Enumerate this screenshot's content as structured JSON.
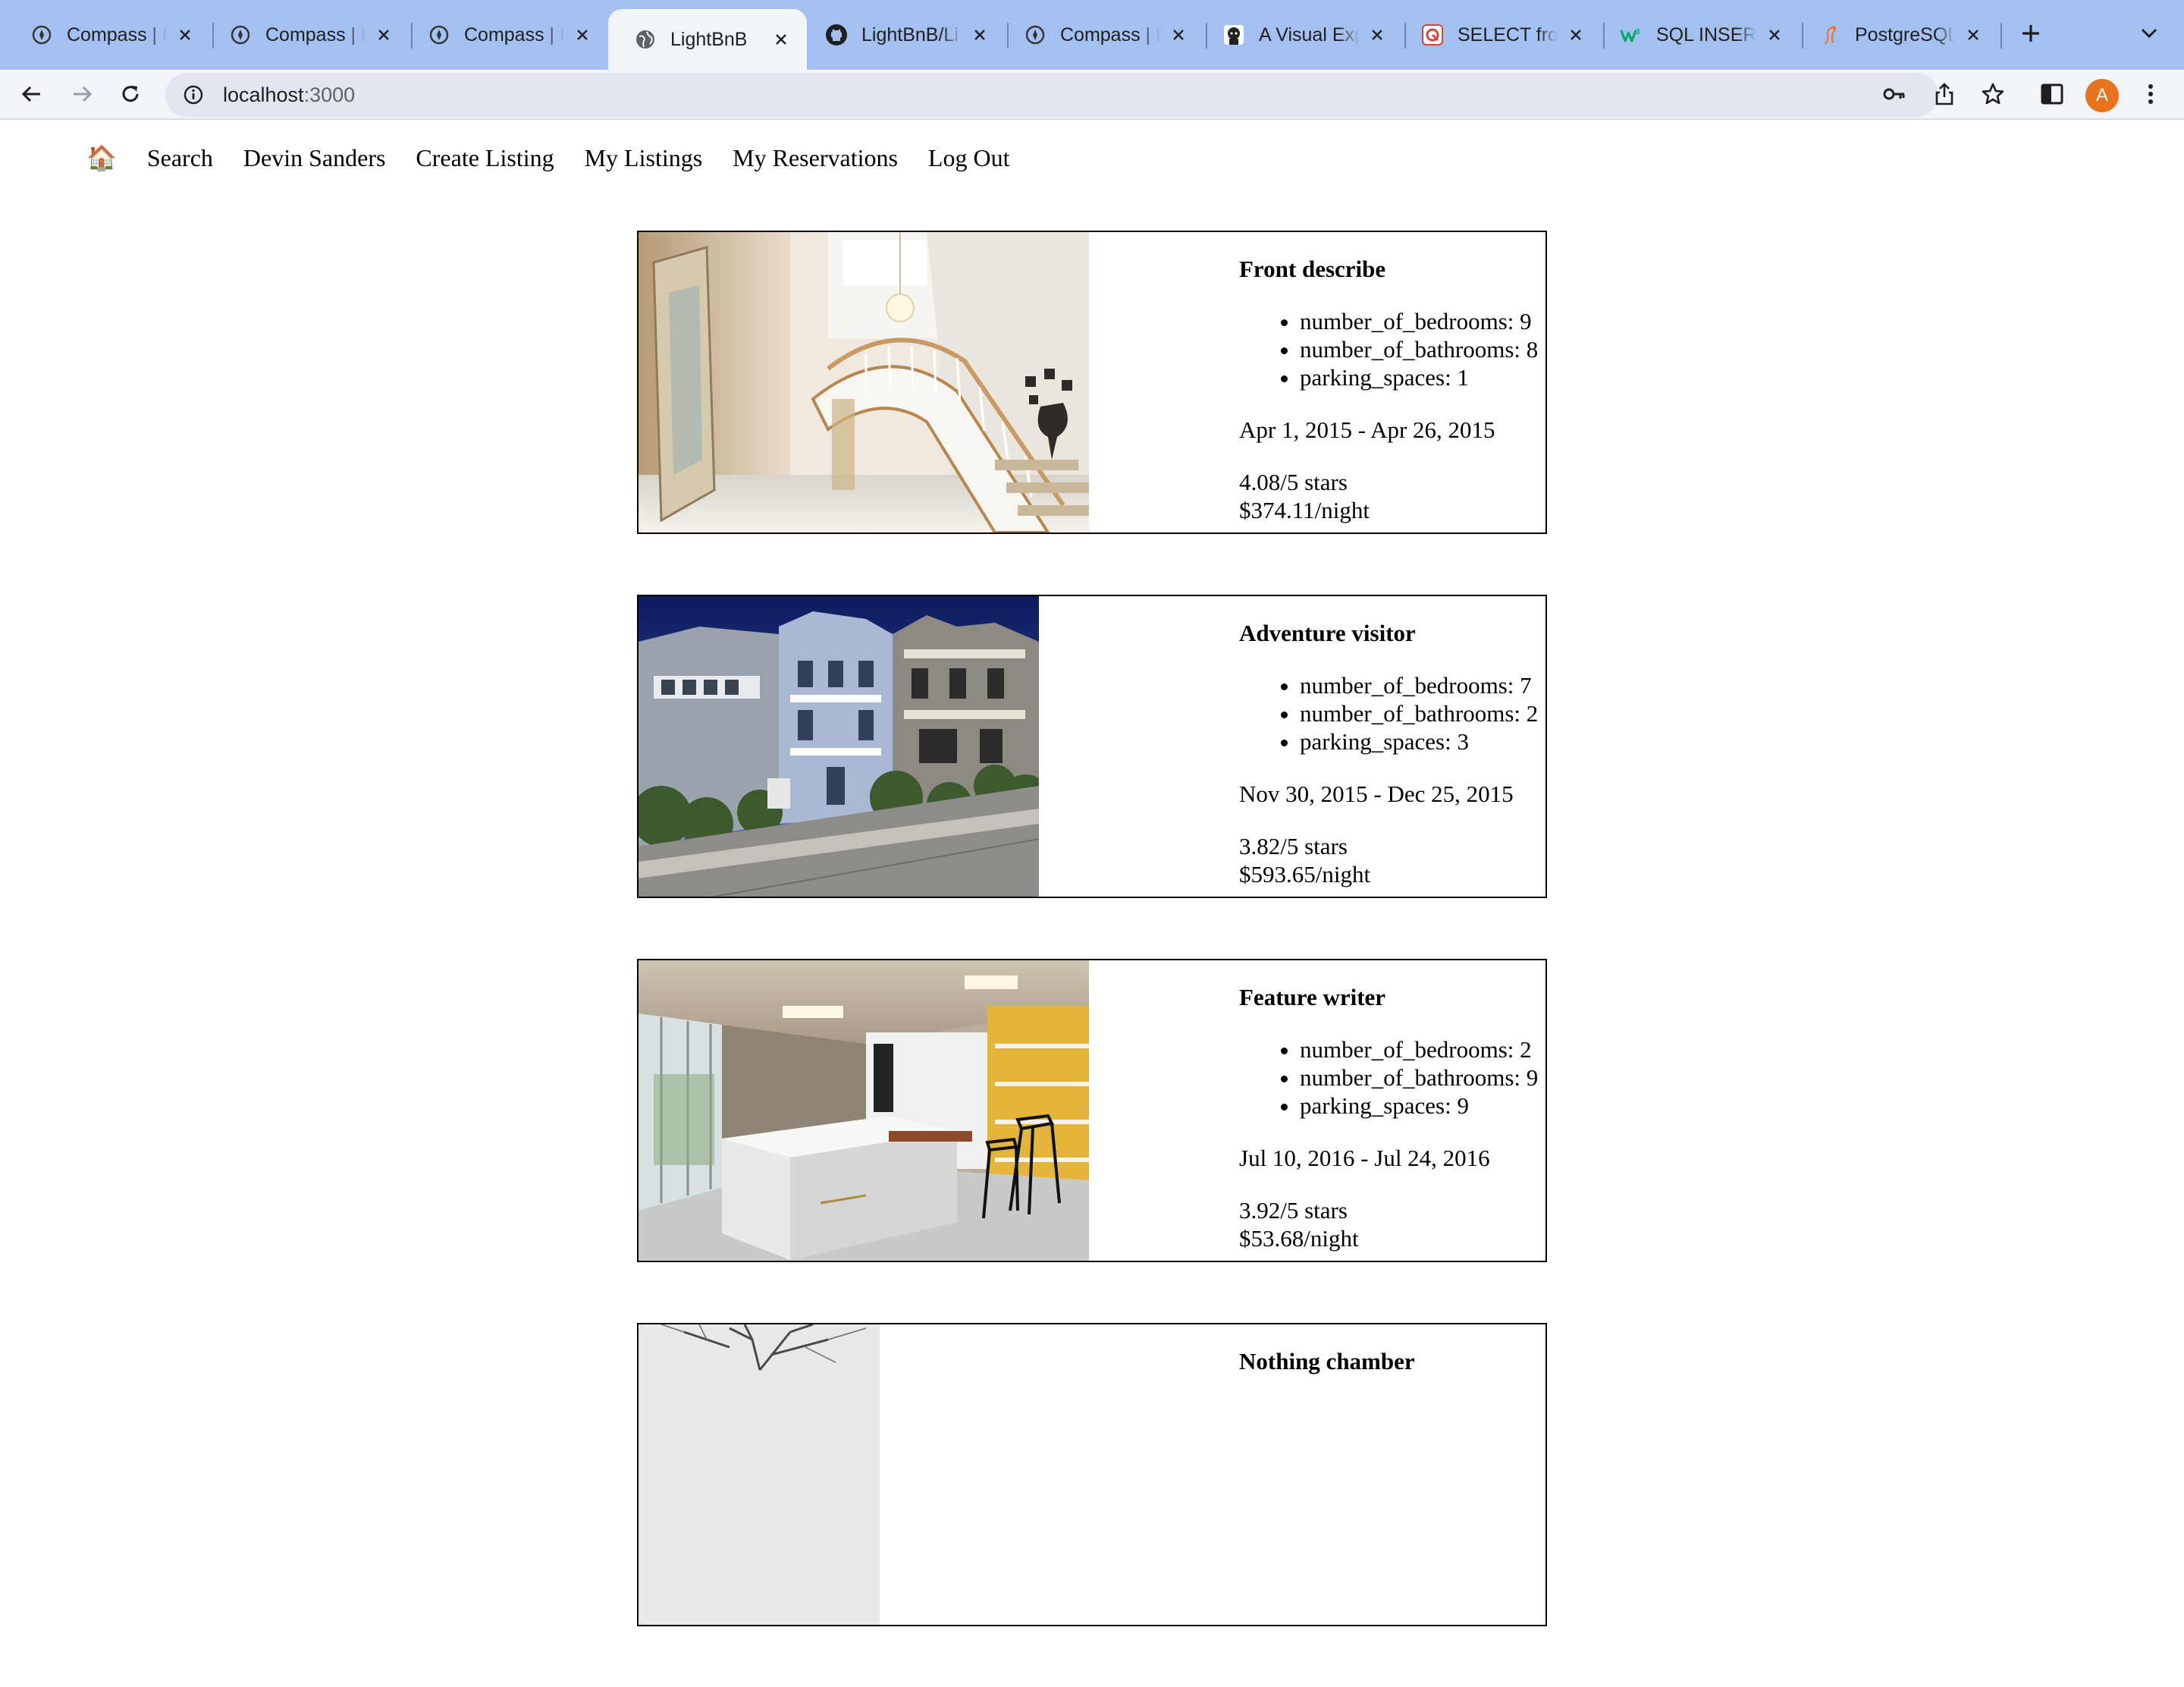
{
  "browser": {
    "tabs": [
      {
        "title": "Compass | L",
        "icon": "compass-icon",
        "active": false
      },
      {
        "title": "Compass | L",
        "icon": "compass-icon",
        "active": false
      },
      {
        "title": "Compass | L",
        "icon": "compass-icon",
        "active": false
      },
      {
        "title": "LightBnB",
        "icon": "globe-icon",
        "active": true
      },
      {
        "title": "LightBnB/Li",
        "icon": "github-icon",
        "active": false
      },
      {
        "title": "Compass | D",
        "icon": "compass-icon",
        "active": false
      },
      {
        "title": "A Visual Exp",
        "icon": "avatar-favicon-icon",
        "active": false
      },
      {
        "title": "SELECT from",
        "icon": "postgres-tutorial-icon",
        "active": false
      },
      {
        "title": "SQL INSERT",
        "icon": "w3schools-icon",
        "active": false
      },
      {
        "title": "PostgreSQL",
        "icon": "postgres-elephant-icon",
        "active": false
      }
    ],
    "address": {
      "host": "localhost",
      "port": ":3000"
    },
    "profile_initial": "A"
  },
  "nav": {
    "home_glyph": "🏠",
    "links": [
      "Search",
      "Devin Sanders",
      "Create Listing",
      "My Listings",
      "My Reservations",
      "Log Out"
    ]
  },
  "listings": [
    {
      "title": "Front describe",
      "bedrooms": "number_of_bedrooms: 9",
      "bathrooms": "number_of_bathrooms: 8",
      "parking": "parking_spaces: 1",
      "dates": "Apr 1, 2015 - Apr 26, 2015",
      "rating": "4.08/5 stars",
      "price": "$374.11/night",
      "photo": "staircase-foyer"
    },
    {
      "title": "Adventure visitor",
      "bedrooms": "number_of_bedrooms: 7",
      "bathrooms": "number_of_bathrooms: 2",
      "parking": "parking_spaces: 3",
      "dates": "Nov 30, 2015 - Dec 25, 2015",
      "rating": "3.82/5 stars",
      "price": "$593.65/night",
      "photo": "victorian-houses"
    },
    {
      "title": "Feature writer",
      "bedrooms": "number_of_bedrooms: 2",
      "bathrooms": "number_of_bathrooms: 9",
      "parking": "parking_spaces: 9",
      "dates": "Jul 10, 2016 - Jul 24, 2016",
      "rating": "3.92/5 stars",
      "price": "$53.68/night",
      "photo": "modern-kitchen"
    },
    {
      "title": "Nothing chamber",
      "photo": "bare-tree"
    }
  ]
}
